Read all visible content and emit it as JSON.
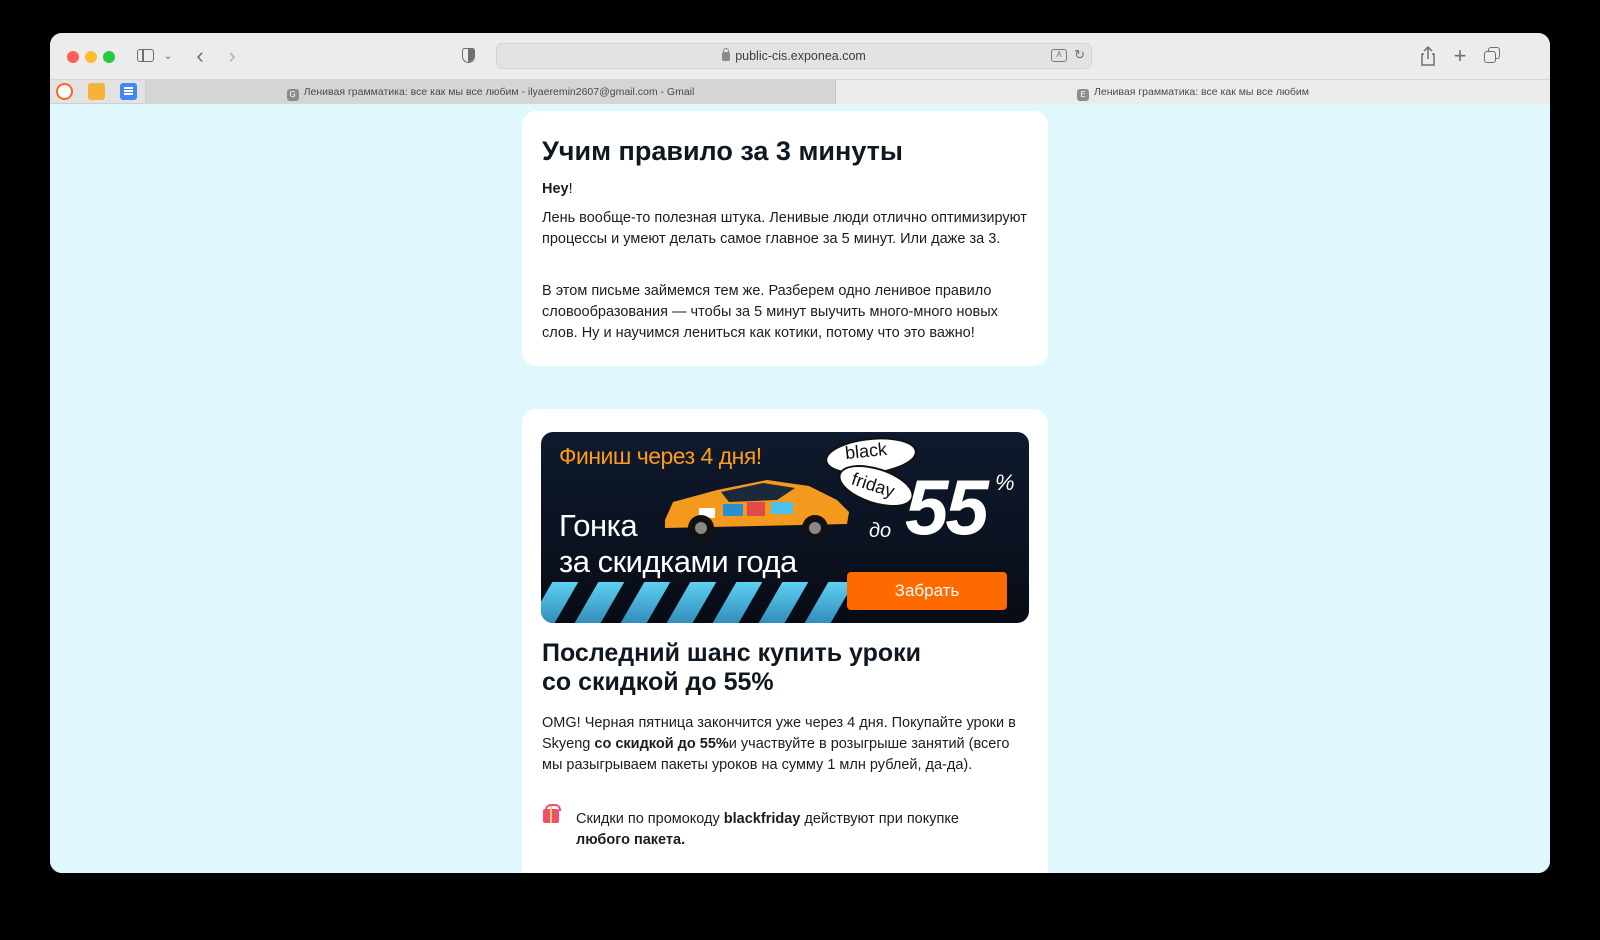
{
  "browser": {
    "address": "public-cis.exponea.com",
    "tabs": [
      {
        "badge": "G",
        "title": "Ленивая грамматика: все как мы все любим - ilyaeremin2607@gmail.com - Gmail"
      },
      {
        "badge": "E",
        "title": "Ленивая грамматика: все как мы все любим"
      }
    ]
  },
  "email": {
    "intro": {
      "heading": "Учим правило за 3 минуты",
      "greeting_name": "Hey",
      "greeting_punct": "!",
      "paragraph1": "Лень вообще-то полезная штука. Ленивые люди отлично оптимизируют процессы и умеют делать самое главное за 5 минут. Или даже за 3.",
      "paragraph2": "В этом письме займемся тем же. Разберем одно ленивое правило словообразования — чтобы за 5 минут выучить много-много новых слов. Ну и научимся лениться как котики, потому что это важно!"
    },
    "promo": {
      "banner": {
        "finish": "Финиш через 4 дня!",
        "race_line1": "Гонка",
        "race_line2": "за скидками года",
        "badge_line1": "black",
        "badge_line2": "friday",
        "do": "до",
        "discount": "55",
        "percent": "%",
        "cta": "Забрать"
      },
      "heading_line1": "Последний шанс купить уроки",
      "heading_line2": "со скидкой до 55%",
      "paragraph_a": "OMG! Черная пятница закончится уже через 4 дня. Покупайте уроки в Skyeng ",
      "paragraph_bold": "со скидкой до 55%",
      "paragraph_b": "и участвуйте в розыгрыше занятий (всего мы разыгрываем пакеты уроков на сумму 1 млн рублей, да-да).",
      "bullet_a": "Скидки по промокоду ",
      "bullet_code": "blackfriday",
      "bullet_b": " действуют при покупке ",
      "bullet_bold": "любого пакета."
    }
  },
  "colors": {
    "page_bg": "#dff7fd",
    "accent_orange": "#ff6a00",
    "banner_bg": "#0e1a2d",
    "text_dark": "#0f1720"
  },
  "icons": {
    "toolbar": [
      "sidebar-icon",
      "chevron-down-icon",
      "back-icon",
      "forward-icon",
      "shield-icon",
      "lock-icon",
      "translate-icon",
      "reload-icon",
      "share-icon",
      "plus-icon",
      "tabs-overview-icon"
    ],
    "bookmarks": [
      "bookmark-radio-icon",
      "bookmark-analytics-icon",
      "bookmark-docs-icon"
    ],
    "bullet": "gift-icon"
  }
}
